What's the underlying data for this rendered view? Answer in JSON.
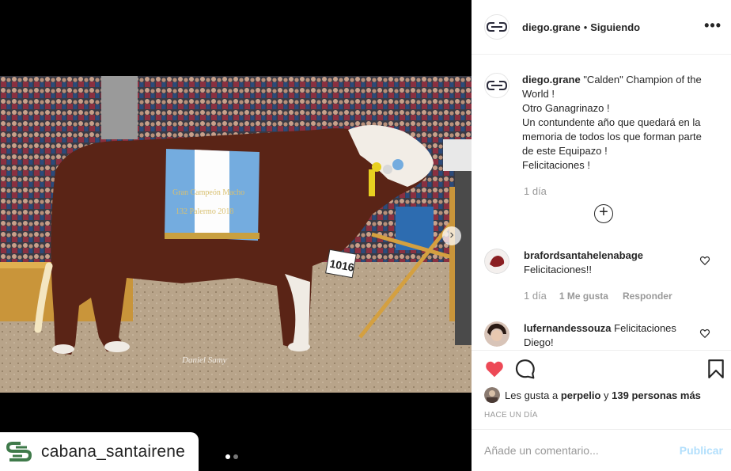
{
  "header": {
    "username": "diego.grane",
    "separator": "•",
    "follow_status": "Siguiendo",
    "more_label": "•••"
  },
  "caption": {
    "username": "diego.grane",
    "text": "\"Calden\" Champion of the World !\nOtro Ganagrinazo !\nUn contundente año que quedará en la memoria de todos los que forman parte de este Equipazo !\nFelicitaciones !",
    "time": "1 día"
  },
  "load_more": "+",
  "comments": [
    {
      "username": "brafordsantahelenabage",
      "text": "Felicitaciones!!",
      "time": "1 día",
      "likes": "1 Me gusta",
      "reply": "Responder"
    },
    {
      "username": "lufernandessouza",
      "text": "Felicitaciones Diego!"
    }
  ],
  "likes": {
    "prefix": "Les gusta a",
    "user": "perpelio",
    "middle": "y",
    "count": "139 personas más"
  },
  "timestamp": "HACE UN DÍA",
  "add_comment": {
    "placeholder": "Añade un comentario...",
    "publish": "Publicar"
  },
  "watermark": {
    "account": "cabana_santairene"
  },
  "photo": {
    "sash_text": "Gran Campeón Macho\n132 Palermo 2018",
    "tag_number": "1016",
    "signature": "Daniel Samy"
  },
  "colors": {
    "like_red": "#ed4956",
    "publish_disabled": "#b2dffc",
    "sash_blue": "#74acdf",
    "bull_brown": "#5a2416",
    "watermark_green": "#3f7a4a"
  },
  "icons": [
    "logo-icon",
    "more-icon",
    "plus-circle-icon",
    "heart-outline-icon",
    "heart-filled-icon",
    "comment-icon",
    "bookmark-icon",
    "next-arrow-icon"
  ]
}
